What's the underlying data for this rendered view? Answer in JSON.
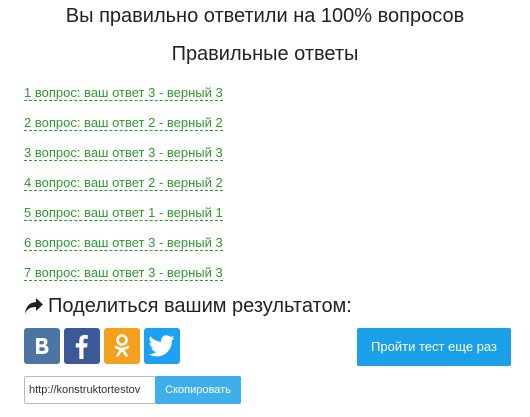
{
  "result": {
    "title": "Вы правильно ответили на 100% вопросов"
  },
  "answers_section": {
    "title": "Правильные ответы",
    "items": [
      "1 вопрос: ваш ответ 3 - верный 3",
      "2 вопрос: ваш ответ 2 - верный 2",
      "3 вопрос: ваш ответ 3 - верный 3",
      "4 вопрос: ваш ответ 2 - верный 2",
      "5 вопрос: ваш ответ 1 - верный 1",
      "6 вопрос: ваш ответ 3 - верный 3",
      "7 вопрос: ваш ответ 3 - верный 3"
    ],
    "link_color": "#2e9a2e"
  },
  "share": {
    "heading": "Поделиться вашим результатом:",
    "icon": "share-arrow-icon",
    "networks": [
      {
        "name": "vk",
        "icon": "vk-icon",
        "color": "#4c75a3"
      },
      {
        "name": "facebook",
        "icon": "facebook-icon",
        "color": "#3b5998"
      },
      {
        "name": "odnoklassniki",
        "icon": "odnoklassniki-icon",
        "color": "#f5a01d"
      },
      {
        "name": "twitter",
        "icon": "twitter-icon",
        "color": "#1da1f2"
      }
    ]
  },
  "retry": {
    "label": "Пройти тест еще раз",
    "color": "#1aa0e8"
  },
  "link": {
    "value": "http://konstruktortestov",
    "copy_label": "Скопировать"
  }
}
